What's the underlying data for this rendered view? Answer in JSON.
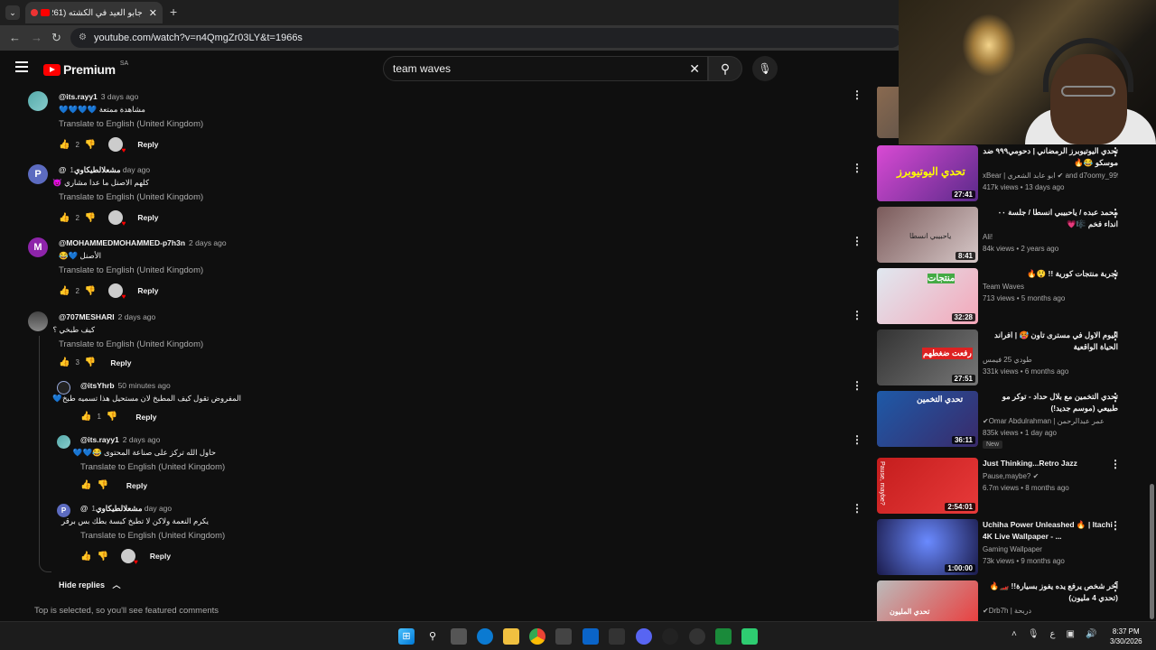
{
  "browser": {
    "tab_title": "جابو العيد في الكشته (261)",
    "url": "youtube.com/watch?v=n4QmgZr03LY&t=1966s"
  },
  "header": {
    "logo_text": "Premium",
    "region": "SA",
    "search_value": "team waves"
  },
  "comments": [
    {
      "author": "@its.rayy1",
      "ago": "3 days ago",
      "text": "مشاهدة ممتعة 💙💙💙💙",
      "translate": "Translate to English (United Kingdom)",
      "likes": "2",
      "reply": "Reply"
    },
    {
      "author": "@مشعلالطيكاوي",
      "ago": "1 day ago",
      "text": "كلهم الاصنل ما عدا مشاري 😈",
      "translate": "Translate to English (United Kingdom)",
      "likes": "2",
      "reply": "Reply"
    },
    {
      "author": "@MOHAMMEDMOHAMMED-p7h3n",
      "ago": "2 days ago",
      "text": "الأصنل 💙😂",
      "translate": "Translate to English (United Kingdom)",
      "likes": "2",
      "reply": "Reply"
    },
    {
      "author": "@707MESHARI",
      "ago": "2 days ago",
      "text": "كيف طبخي ؟",
      "translate": "Translate to English (United Kingdom)",
      "likes": "3",
      "reply": "Reply"
    }
  ],
  "replies": [
    {
      "author": "@itsYhrb",
      "ago": "50 minutes ago",
      "text": "المفروض تقول كيف المطبخ لان مستحيل هذا تسميه طبخ💙",
      "likes": "1",
      "reply": "Reply"
    },
    {
      "author": "@its.rayy1",
      "ago": "2 days ago",
      "text": "حاول الله تركز على صناعة المحتوى 😂💙💙",
      "translate": "Translate to English (United Kingdom)",
      "reply": "Reply"
    },
    {
      "author": "@مشعلالطيكاوي",
      "ago": "1 day ago",
      "text": "يكرم النعمة ولاكن  لا تطبخ كبسة بطك بس برقر",
      "translate": "Translate to English (United Kingdom)",
      "reply": "Reply"
    }
  ],
  "hide_replies": "Hide replies",
  "featured_note": "Top is selected, so you'll see featured comments",
  "videos": [
    {
      "title": "تحدي اليوتيوبرز الرمضاني | دحومي٩٩٩ ضد موسكو 😂🔥",
      "channel": "xBear | ابو عابد الشعري ✔ and d7oomy_999 ...",
      "meta": "417k views • 13 days ago",
      "duration": "27:41",
      "thumb_text": "تحدي اليوتيوبرز"
    },
    {
      "title": "محمد عبده / ياحبيبي انسطا / جلسة ٠٠ انداء فخم 🎼💗",
      "channel": "Ali!",
      "meta": "84k views • 2 years ago",
      "duration": "8:41",
      "thumb_text": "ياحبيبي انسطا"
    },
    {
      "title": "تجربة منتجات كورية !! 😲🔥",
      "channel": "Team Waves",
      "meta": "713 views • 5 months ago",
      "duration": "32:28",
      "thumb_text": "منتجات"
    },
    {
      "title": "اليوم الاول في مسترى تاون 🥵 | افراند الحياة الواقعية",
      "channel": "طودي 25 فيمس",
      "meta": "331k views • 6 months ago",
      "duration": "27:51",
      "thumb_text": "رفعت ضغطهم"
    },
    {
      "title": "تحدي التخمين مع بلال حداد - توكر مو طبيعي (موسم جديد!)",
      "channel": "✔Omar Abdulrahman | عمر عبدالرحمن",
      "meta": "835k views • 1 day ago",
      "duration": "36:11",
      "badge": "New",
      "thumb_text": "تحدي التخمين"
    },
    {
      "title": "Just Thinking...Retro Jazz",
      "channel": "Pause,maybe? ✔",
      "meta": "6.7m views • 8 months ago",
      "duration": "2:54:01",
      "thumb_text": "Pause, maybe?"
    },
    {
      "title": "Uchiha Power Unleashed 🔥 | Itachi 4K Live Wallpaper - ...",
      "channel": "Gaming Wallpaper",
      "meta": "73k views • 9 months ago",
      "duration": "1:00:00",
      "thumb_text": ""
    },
    {
      "title": "آخر شخص يرفع يده يفوز بسيارة!! 🏎️🔥 (تحدي 4 مليون)",
      "channel": "✔Drb7h | دربحة",
      "meta": "",
      "duration": "",
      "thumb_text": "تحدي المليون"
    }
  ],
  "clock": {
    "time": "8:37 PM",
    "date": "3/30/2026"
  },
  "tray": {
    "lang": "ع"
  },
  "colors": {
    "background": "#0f0f0f",
    "accent": "#ff0000",
    "text": "#f1f1f1",
    "secondary": "#aaaaaa"
  }
}
